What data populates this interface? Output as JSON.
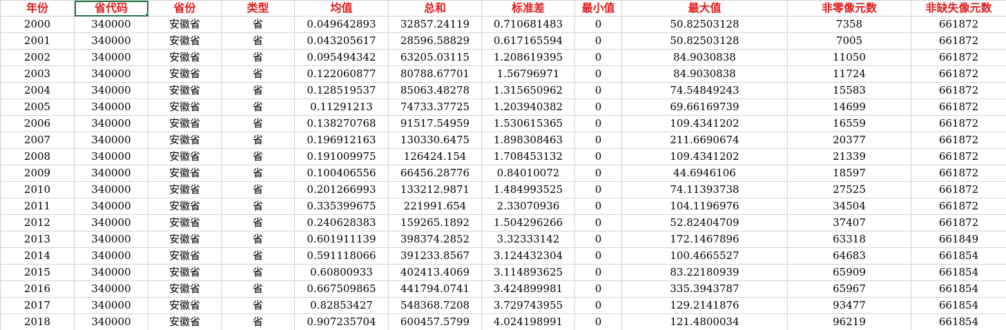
{
  "colors": {
    "header_text": "#e21b1b",
    "gridline": "#d4d4d4",
    "selection": "#217346"
  },
  "headers": [
    "年份",
    "省代码",
    "省份",
    "类型",
    "均值",
    "总和",
    "标准差",
    "最小值",
    "最大值",
    "非零像元数",
    "非缺失像元数"
  ],
  "rows": [
    [
      "2000",
      "340000",
      "安徽省",
      "省",
      "0.049642893",
      "32857.24119",
      "0.710681483",
      "0",
      "50.82503128",
      "7358",
      "661872"
    ],
    [
      "2001",
      "340000",
      "安徽省",
      "省",
      "0.043205617",
      "28596.58829",
      "0.617165594",
      "0",
      "50.82503128",
      "7005",
      "661872"
    ],
    [
      "2002",
      "340000",
      "安徽省",
      "省",
      "0.095494342",
      "63205.03115",
      "1.208619395",
      "0",
      "84.9030838",
      "11050",
      "661872"
    ],
    [
      "2003",
      "340000",
      "安徽省",
      "省",
      "0.122060877",
      "80788.67701",
      "1.56796971",
      "0",
      "84.9030838",
      "11724",
      "661872"
    ],
    [
      "2004",
      "340000",
      "安徽省",
      "省",
      "0.128519537",
      "85063.48278",
      "1.315650962",
      "0",
      "74.54849243",
      "15583",
      "661872"
    ],
    [
      "2005",
      "340000",
      "安徽省",
      "省",
      "0.11291213",
      "74733.37725",
      "1.203940382",
      "0",
      "69.66169739",
      "14699",
      "661872"
    ],
    [
      "2006",
      "340000",
      "安徽省",
      "省",
      "0.138270768",
      "91517.54959",
      "1.530615365",
      "0",
      "109.4341202",
      "16559",
      "661872"
    ],
    [
      "2007",
      "340000",
      "安徽省",
      "省",
      "0.196912163",
      "130330.6475",
      "1.898308463",
      "0",
      "211.6690674",
      "20377",
      "661872"
    ],
    [
      "2008",
      "340000",
      "安徽省",
      "省",
      "0.191009975",
      "126424.154",
      "1.708453132",
      "0",
      "109.4341202",
      "21339",
      "661872"
    ],
    [
      "2009",
      "340000",
      "安徽省",
      "省",
      "0.100406556",
      "66456.28776",
      "0.84010072",
      "0",
      "44.6946106",
      "18597",
      "661872"
    ],
    [
      "2010",
      "340000",
      "安徽省",
      "省",
      "0.201266993",
      "133212.9871",
      "1.484993525",
      "0",
      "74.11393738",
      "27525",
      "661872"
    ],
    [
      "2011",
      "340000",
      "安徽省",
      "省",
      "0.335399675",
      "221991.654",
      "2.33070936",
      "0",
      "104.1196976",
      "34504",
      "661872"
    ],
    [
      "2012",
      "340000",
      "安徽省",
      "省",
      "0.240628383",
      "159265.1892",
      "1.504296266",
      "0",
      "52.82404709",
      "37407",
      "661872"
    ],
    [
      "2013",
      "340000",
      "安徽省",
      "省",
      "0.601911139",
      "398374.2852",
      "3.32333142",
      "0",
      "172.1467896",
      "63318",
      "661849"
    ],
    [
      "2014",
      "340000",
      "安徽省",
      "省",
      "0.591118066",
      "391233.8567",
      "3.124432304",
      "0",
      "100.4665527",
      "64683",
      "661854"
    ],
    [
      "2015",
      "340000",
      "安徽省",
      "省",
      "0.60800933",
      "402413.4069",
      "3.114893625",
      "0",
      "83.22180939",
      "65909",
      "661854"
    ],
    [
      "2016",
      "340000",
      "安徽省",
      "省",
      "0.667509865",
      "441794.0741",
      "3.424899981",
      "0",
      "335.3943787",
      "65967",
      "661854"
    ],
    [
      "2017",
      "340000",
      "安徽省",
      "省",
      "0.82853427",
      "548368.7208",
      "3.729743955",
      "0",
      "129.2141876",
      "93477",
      "661854"
    ],
    [
      "2018",
      "340000",
      "安徽省",
      "省",
      "0.907235704",
      "600457.5799",
      "4.024198991",
      "0",
      "121.4800034",
      "96219",
      "661854"
    ]
  ]
}
